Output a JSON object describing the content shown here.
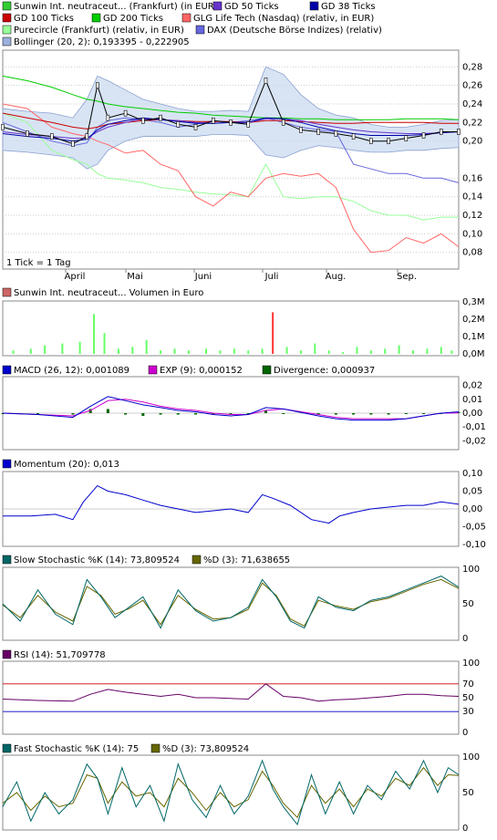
{
  "colors": {
    "price": "#000000",
    "gd50": "#6633cc",
    "gd38": "#0000aa",
    "gd100": "#cc0000",
    "gd200": "#00cc00",
    "glg": "#ff6666",
    "pure": "#99ff99",
    "dax": "#6666dd",
    "boll_fill": "#c8d8f0",
    "boll_line": "#8aa0d0",
    "macd": "#0000cc",
    "exp": "#cc00cc",
    "div": "#006600",
    "mom": "#0000cc",
    "stk": "#006666",
    "std": "#666600",
    "rsi": "#660066",
    "rsi70": "#cc0000",
    "rsi30": "#0000cc",
    "vol": "#66ff66"
  },
  "legend": {
    "items": [
      {
        "label": "Sunwin Int. neutraceut... (Frankfurt) (in EUR)",
        "color": "#33cc33"
      },
      {
        "label": "GD 50 Ticks",
        "color": "#6633cc"
      },
      {
        "label": "GD 38 Ticks",
        "color": "#0000aa"
      },
      {
        "label": "GD 100 Ticks",
        "color": "#cc0000"
      },
      {
        "label": "GD 200 Ticks",
        "color": "#00cc00"
      },
      {
        "label": "GLG Life Tech (Nasdaq) (relativ, in EUR)",
        "color": "#ff6666"
      },
      {
        "label": "Purecircle (Frankfurt) (relativ, in EUR)",
        "color": "#99ff99"
      },
      {
        "label": "DAX (Deutsche Börse Indizes) (relativ)",
        "color": "#6666dd"
      },
      {
        "label": "Bollinger (20, 2): 0,193395 - 0,222905",
        "color": "#9bb0dc"
      }
    ]
  },
  "price_axis": [
    "0,28",
    "0,26",
    "0,24",
    "0,22",
    "0,20",
    "0,16",
    "0,14",
    "0,12",
    "0,10",
    "0,08"
  ],
  "tick_note": "1 Tick = 1 Tag",
  "months": [
    "April",
    "Mai",
    "Juni",
    "Juli",
    "Aug.",
    "Sep."
  ],
  "volume": {
    "title": "Sunwin Int. neutraceut... Volumen in Euro",
    "axis": [
      "0,3M",
      "0,2M",
      "0,1M",
      "0,0M"
    ]
  },
  "macd": {
    "l1": "MACD (26, 12): 0,001089",
    "l2": "EXP (9): 0,000152",
    "l3": "Divergence: 0,000937",
    "axis": [
      "0,02",
      "0,01",
      "0,00",
      "-0,01",
      "-0,02"
    ]
  },
  "momentum": {
    "title": "Momentum (20): 0,013",
    "axis": [
      "0,10",
      "0,05",
      "0,00",
      "-0,05",
      "-0,10"
    ]
  },
  "slow": {
    "l1": "Slow Stochastic %K (14): 73,809524",
    "l2": "%D (3): 71,638655",
    "axis": [
      "100",
      "50",
      "0"
    ]
  },
  "rsi": {
    "title": "RSI (14): 51,709778",
    "axis": [
      "100",
      "70",
      "50",
      "30",
      "0"
    ]
  },
  "fast": {
    "l1": "Fast Stochastic %K (14): 75",
    "l2": "%D (3): 73,809524",
    "axis": [
      "100",
      "50",
      "0"
    ]
  },
  "chart_data": {
    "type": "line",
    "price": {
      "ylim": [
        0.065,
        0.295
      ],
      "x": [
        0,
        7,
        14,
        20,
        24,
        27,
        30,
        35,
        40,
        45,
        50,
        55,
        60,
        65,
        70,
        75,
        80,
        85,
        90,
        95,
        100,
        105,
        110,
        115,
        120,
        125,
        130
      ],
      "close": [
        0.215,
        0.208,
        0.205,
        0.197,
        0.205,
        0.26,
        0.225,
        0.23,
        0.222,
        0.225,
        0.218,
        0.215,
        0.222,
        0.22,
        0.218,
        0.265,
        0.22,
        0.212,
        0.21,
        0.208,
        0.205,
        0.2,
        0.2,
        0.203,
        0.206,
        0.21,
        0.21
      ],
      "glg": [
        0.24,
        0.235,
        0.215,
        0.208,
        0.205,
        0.2,
        0.196,
        0.187,
        0.19,
        0.175,
        0.168,
        0.14,
        0.13,
        0.145,
        0.14,
        0.16,
        0.165,
        0.162,
        0.165,
        0.15,
        0.105,
        0.08,
        0.082,
        0.096,
        0.09,
        0.1,
        0.086
      ],
      "pure": [
        0.23,
        0.22,
        0.19,
        0.18,
        0.175,
        0.165,
        0.16,
        0.158,
        0.155,
        0.15,
        0.148,
        0.145,
        0.143,
        0.142,
        0.14,
        0.175,
        0.14,
        0.138,
        0.14,
        0.14,
        0.135,
        0.125,
        0.12,
        0.12,
        0.115,
        0.118,
        0.118
      ],
      "dax": [
        0.22,
        0.21,
        0.2,
        0.195,
        0.198,
        0.215,
        0.222,
        0.225,
        0.223,
        0.22,
        0.215,
        0.218,
        0.222,
        0.22,
        0.222,
        0.225,
        0.22,
        0.215,
        0.212,
        0.21,
        0.175,
        0.17,
        0.165,
        0.165,
        0.16,
        0.16,
        0.155
      ],
      "gd200": [
        0.27,
        0.265,
        0.258,
        0.25,
        0.245,
        0.243,
        0.24,
        0.237,
        0.235,
        0.233,
        0.231,
        0.23,
        0.228,
        0.227,
        0.226,
        0.225,
        0.225,
        0.224,
        0.224,
        0.223,
        0.223,
        0.223,
        0.223,
        0.224,
        0.224,
        0.224,
        0.223
      ],
      "gd100": [
        0.23,
        0.225,
        0.22,
        0.215,
        0.213,
        0.215,
        0.218,
        0.22,
        0.222,
        0.223,
        0.222,
        0.221,
        0.221,
        0.221,
        0.22,
        0.222,
        0.222,
        0.221,
        0.22,
        0.219,
        0.219,
        0.22,
        0.22,
        0.22,
        0.22,
        0.219,
        0.219
      ],
      "gd50": [
        0.21,
        0.207,
        0.205,
        0.203,
        0.203,
        0.21,
        0.215,
        0.22,
        0.224,
        0.223,
        0.222,
        0.22,
        0.219,
        0.22,
        0.22,
        0.224,
        0.224,
        0.222,
        0.218,
        0.215,
        0.212,
        0.21,
        0.209,
        0.208,
        0.208,
        0.209,
        0.21
      ],
      "gd38": [
        0.208,
        0.205,
        0.203,
        0.2,
        0.202,
        0.212,
        0.218,
        0.222,
        0.225,
        0.223,
        0.221,
        0.219,
        0.219,
        0.22,
        0.22,
        0.225,
        0.224,
        0.22,
        0.215,
        0.211,
        0.208,
        0.206,
        0.206,
        0.206,
        0.207,
        0.209,
        0.21
      ],
      "boll_hi": [
        0.235,
        0.232,
        0.23,
        0.225,
        0.245,
        0.27,
        0.265,
        0.255,
        0.245,
        0.24,
        0.235,
        0.232,
        0.232,
        0.233,
        0.232,
        0.28,
        0.272,
        0.25,
        0.235,
        0.228,
        0.225,
        0.218,
        0.215,
        0.215,
        0.218,
        0.222,
        0.223
      ],
      "boll_lo": [
        0.19,
        0.188,
        0.185,
        0.182,
        0.17,
        0.175,
        0.19,
        0.2,
        0.205,
        0.205,
        0.205,
        0.205,
        0.207,
        0.207,
        0.206,
        0.185,
        0.182,
        0.19,
        0.195,
        0.193,
        0.19,
        0.188,
        0.188,
        0.19,
        0.19,
        0.192,
        0.193
      ]
    },
    "volume_m": {
      "ylim": [
        0,
        0.3
      ],
      "x": [
        3,
        8,
        12,
        17,
        22,
        26,
        29,
        33,
        37,
        41,
        45,
        49,
        53,
        58,
        62,
        66,
        70,
        74,
        77,
        81,
        85,
        89,
        93,
        97,
        101,
        105,
        109,
        113,
        117,
        121,
        125,
        128
      ],
      "values": [
        0.02,
        0.03,
        0.05,
        0.06,
        0.07,
        0.23,
        0.12,
        0.03,
        0.04,
        0.08,
        0.02,
        0.03,
        0.02,
        0.03,
        0.02,
        0.03,
        0.02,
        0.03,
        0.24,
        0.04,
        0.02,
        0.06,
        0.02,
        0.01,
        0.04,
        0.02,
        0.03,
        0.05,
        0.02,
        0.03,
        0.04,
        0.02
      ]
    },
    "macd": {
      "ylim": [
        -0.025,
        0.025
      ],
      "x": [
        0,
        10,
        20,
        25,
        30,
        35,
        40,
        45,
        50,
        55,
        60,
        65,
        70,
        75,
        80,
        90,
        95,
        100,
        105,
        110,
        115,
        120,
        125,
        130
      ],
      "macd": [
        0,
        -0.001,
        -0.003,
        0.005,
        0.012,
        0.009,
        0.006,
        0.004,
        0.002,
        0.001,
        -0.001,
        -0.002,
        -0.001,
        0.004,
        0.003,
        -0.002,
        -0.004,
        -0.005,
        -0.005,
        -0.005,
        -0.004,
        -0.002,
        0,
        0.001
      ],
      "exp": [
        0,
        -0.001,
        -0.002,
        0.002,
        0.009,
        0.01,
        0.008,
        0.005,
        0.003,
        0.002,
        0,
        -0.001,
        -0.001,
        0.002,
        0.003,
        -0.001,
        -0.003,
        -0.004,
        -0.004,
        -0.004,
        -0.004,
        -0.002,
        0,
        0.0002
      ]
    },
    "momentum": {
      "ylim": [
        -0.1,
        0.1
      ],
      "x": [
        0,
        8,
        15,
        20,
        23,
        27,
        30,
        35,
        40,
        45,
        50,
        55,
        60,
        65,
        70,
        74,
        77,
        82,
        88,
        93,
        96,
        100,
        105,
        110,
        115,
        120,
        125,
        130
      ],
      "values": [
        -0.02,
        -0.02,
        -0.015,
        -0.03,
        0.02,
        0.065,
        0.05,
        0.04,
        0.025,
        0.01,
        0,
        -0.01,
        -0.005,
        0,
        -0.01,
        0.04,
        0.03,
        0.01,
        -0.03,
        -0.04,
        -0.02,
        -0.01,
        0,
        0.005,
        0.01,
        0.01,
        0.02,
        0.013
      ]
    },
    "slow": {
      "ylim": [
        0,
        100
      ],
      "x": [
        0,
        5,
        10,
        15,
        20,
        24,
        28,
        32,
        36,
        40,
        45,
        50,
        55,
        60,
        65,
        70,
        74,
        78,
        82,
        86,
        90,
        95,
        100,
        105,
        110,
        115,
        120,
        125,
        130
      ],
      "k": [
        50,
        25,
        70,
        35,
        20,
        85,
        60,
        30,
        45,
        60,
        15,
        70,
        40,
        25,
        30,
        45,
        85,
        60,
        25,
        15,
        60,
        45,
        40,
        55,
        60,
        70,
        80,
        90,
        74
      ],
      "d": [
        48,
        30,
        62,
        38,
        25,
        75,
        62,
        35,
        43,
        55,
        20,
        62,
        42,
        28,
        30,
        42,
        80,
        62,
        28,
        18,
        55,
        47,
        42,
        53,
        58,
        68,
        78,
        85,
        72
      ]
    },
    "rsi": {
      "ylim": [
        0,
        100
      ],
      "x": [
        0,
        10,
        20,
        25,
        30,
        35,
        40,
        45,
        50,
        55,
        60,
        65,
        70,
        75,
        80,
        85,
        90,
        95,
        100,
        105,
        110,
        115,
        120,
        125,
        130
      ],
      "values": [
        48,
        46,
        45,
        55,
        62,
        58,
        55,
        52,
        55,
        50,
        50,
        49,
        48,
        70,
        52,
        50,
        45,
        47,
        48,
        50,
        52,
        55,
        55,
        53,
        52
      ]
    },
    "fast": {
      "ylim": [
        0,
        100
      ],
      "x": [
        0,
        4,
        8,
        12,
        16,
        20,
        24,
        27,
        30,
        34,
        38,
        42,
        46,
        50,
        54,
        58,
        62,
        66,
        70,
        74,
        77,
        80,
        84,
        88,
        92,
        96,
        100,
        104,
        108,
        112,
        116,
        120,
        124,
        127,
        130
      ],
      "k": [
        30,
        65,
        10,
        50,
        20,
        40,
        90,
        70,
        20,
        85,
        30,
        60,
        10,
        90,
        40,
        15,
        60,
        20,
        45,
        95,
        55,
        30,
        5,
        75,
        20,
        65,
        20,
        60,
        40,
        80,
        55,
        95,
        50,
        85,
        75
      ],
      "d": [
        35,
        50,
        25,
        45,
        30,
        35,
        75,
        70,
        35,
        65,
        45,
        50,
        30,
        70,
        50,
        25,
        50,
        30,
        40,
        80,
        60,
        35,
        15,
        60,
        35,
        55,
        30,
        55,
        45,
        70,
        60,
        85,
        60,
        75,
        74
      ]
    }
  }
}
